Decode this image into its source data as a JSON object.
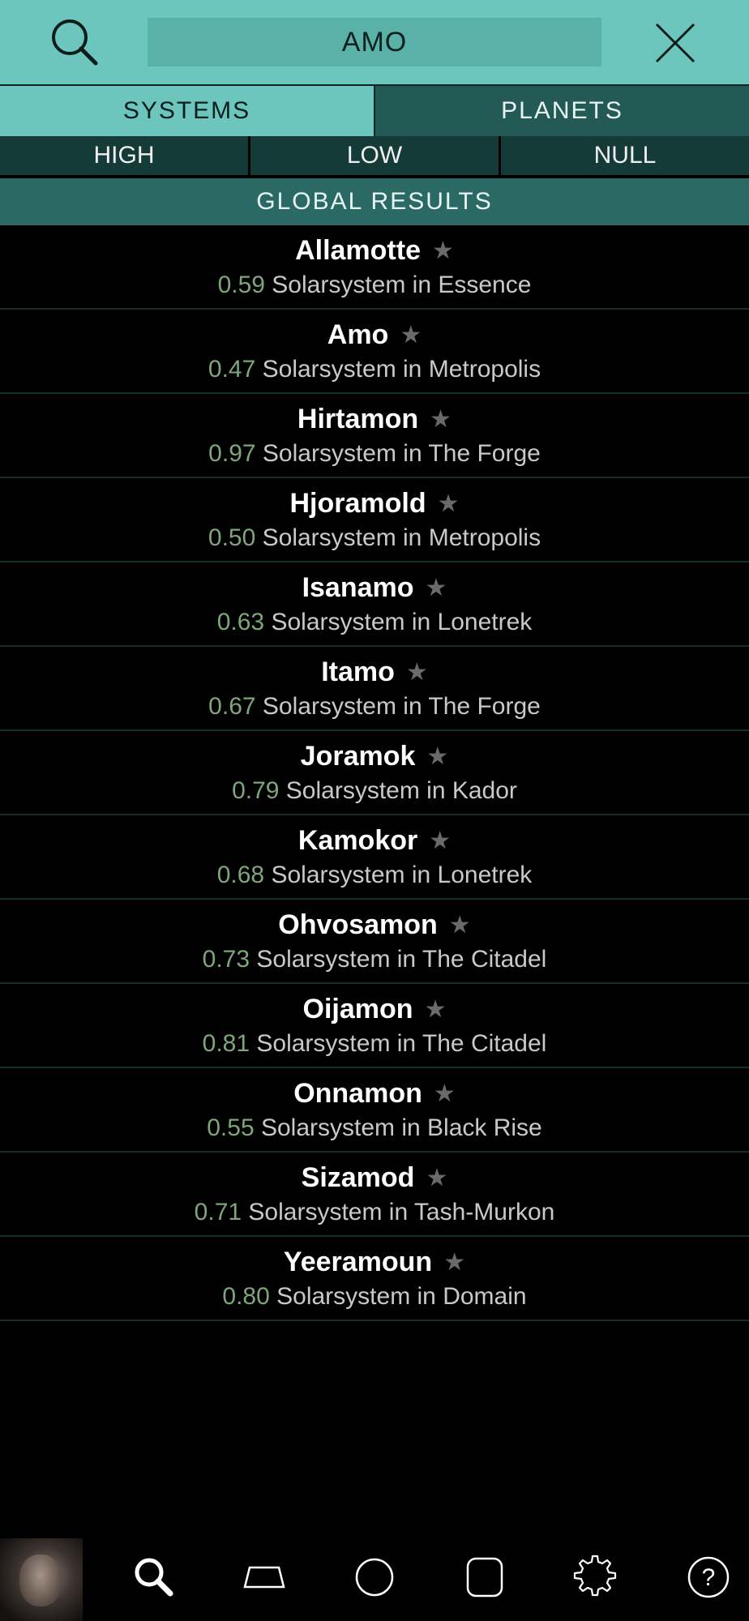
{
  "search": {
    "query": "AMO"
  },
  "tabs": [
    {
      "label": "SYSTEMS",
      "active": true
    },
    {
      "label": "PLANETS",
      "active": false
    }
  ],
  "filters": [
    {
      "label": "HIGH"
    },
    {
      "label": "LOW"
    },
    {
      "label": "NULL"
    }
  ],
  "results_header": "GLOBAL RESULTS",
  "results": [
    {
      "name": "Allamotte",
      "security": "0.59",
      "desc": "Solarsystem in Essence"
    },
    {
      "name": "Amo",
      "security": "0.47",
      "desc": "Solarsystem in Metropolis"
    },
    {
      "name": "Hirtamon",
      "security": "0.97",
      "desc": "Solarsystem in The Forge"
    },
    {
      "name": "Hjoramold",
      "security": "0.50",
      "desc": "Solarsystem in Metropolis"
    },
    {
      "name": "Isanamo",
      "security": "0.63",
      "desc": "Solarsystem in Lonetrek"
    },
    {
      "name": "Itamo",
      "security": "0.67",
      "desc": "Solarsystem in The Forge"
    },
    {
      "name": "Joramok",
      "security": "0.79",
      "desc": "Solarsystem in Kador"
    },
    {
      "name": "Kamokor",
      "security": "0.68",
      "desc": "Solarsystem in Lonetrek"
    },
    {
      "name": "Ohvosamon",
      "security": "0.73",
      "desc": "Solarsystem in The Citadel"
    },
    {
      "name": "Oijamon",
      "security": "0.81",
      "desc": "Solarsystem in The Citadel"
    },
    {
      "name": "Onnamon",
      "security": "0.55",
      "desc": "Solarsystem in Black Rise"
    },
    {
      "name": "Sizamod",
      "security": "0.71",
      "desc": "Solarsystem in Tash-Murkon"
    },
    {
      "name": "Yeeramoun",
      "security": "0.80",
      "desc": "Solarsystem in Domain"
    }
  ],
  "bottom_nav": [
    "avatar",
    "search-icon",
    "trapezoid-icon",
    "circle-icon",
    "rounded-square-icon",
    "gear-icon",
    "help-icon"
  ],
  "colors": {
    "accent": "#6cc6bd",
    "tab_inactive": "#245a55",
    "filter_bg": "#143b38",
    "header_bg": "#2b6a64",
    "security": "#7fa67a",
    "star": "#6a6a6a"
  }
}
